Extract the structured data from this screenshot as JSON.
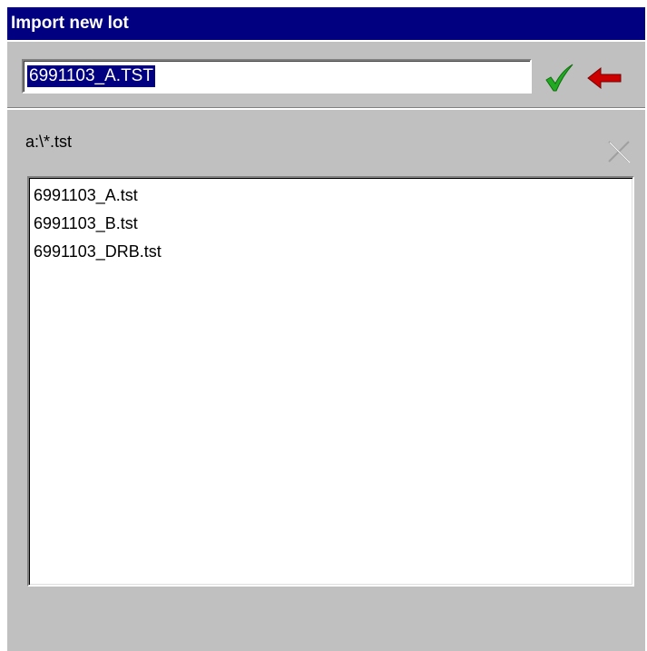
{
  "dialog": {
    "title": "Import new lot"
  },
  "lot_input": {
    "value": "6991103_A.TST"
  },
  "actions": {
    "ok_icon": "checkmark-icon",
    "back_icon": "arrow-left-icon",
    "clear_icon": "close-icon"
  },
  "browser": {
    "path": "a:\\*.tst",
    "files": [
      "6991103_A.tst",
      "6991103_B.tst",
      "6991103_DRB.tst"
    ]
  },
  "colors": {
    "titlebar": "#000080",
    "face": "#c0c0c0",
    "selection": "#000080",
    "ok": "#22aa22",
    "back": "#cc0000",
    "disabled": "#a0a0a0"
  }
}
